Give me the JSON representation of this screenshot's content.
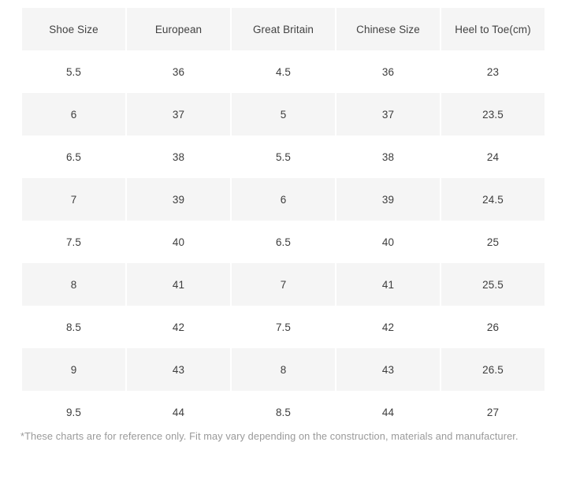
{
  "table": {
    "name": "shoe-size-conversion-chart",
    "columns": [
      "Shoe Size",
      "European",
      "Great Britain",
      "Chinese Size",
      "Heel to Toe(cm)"
    ],
    "rows": [
      [
        "5.5",
        "36",
        "4.5",
        "36",
        "23"
      ],
      [
        "6",
        "37",
        "5",
        "37",
        "23.5"
      ],
      [
        "6.5",
        "38",
        "5.5",
        "38",
        "24"
      ],
      [
        "7",
        "39",
        "6",
        "39",
        "24.5"
      ],
      [
        "7.5",
        "40",
        "6.5",
        "40",
        "25"
      ],
      [
        "8",
        "41",
        "7",
        "41",
        "25.5"
      ],
      [
        "8.5",
        "42",
        "7.5",
        "42",
        "26"
      ],
      [
        "9",
        "43",
        "8",
        "43",
        "26.5"
      ],
      [
        "9.5",
        "44",
        "8.5",
        "44",
        "27"
      ]
    ]
  },
  "footnote": {
    "text": "*These charts are for reference only. Fit may vary depending on the construction, materials and manufacturer."
  },
  "colors": {
    "page_background": "#ffffff",
    "cell_shade": "#f5f5f5",
    "text": "#3d3d3d",
    "header_text": "#424242",
    "footnote_text": "#9a9a9a"
  }
}
